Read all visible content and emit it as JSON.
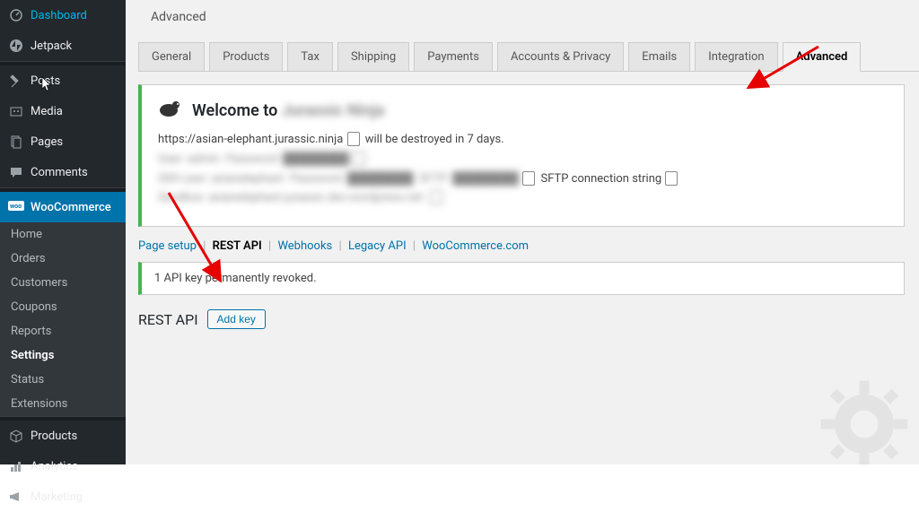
{
  "sidebar": {
    "items": [
      {
        "label": "Dashboard",
        "icon": "dashboard"
      },
      {
        "label": "Jetpack",
        "icon": "jetpack"
      },
      {
        "label": "Posts",
        "icon": "pin"
      },
      {
        "label": "Media",
        "icon": "media"
      },
      {
        "label": "Pages",
        "icon": "page"
      },
      {
        "label": "Comments",
        "icon": "comment"
      },
      {
        "label": "WooCommerce",
        "icon": "woo",
        "current": true
      },
      {
        "label": "Products",
        "icon": "products"
      },
      {
        "label": "Analytics",
        "icon": "analytics"
      },
      {
        "label": "Marketing",
        "icon": "marketing"
      }
    ],
    "submenu": [
      "Home",
      "Orders",
      "Customers",
      "Coupons",
      "Reports",
      "Settings",
      "Status",
      "Extensions"
    ],
    "submenu_current": "Settings"
  },
  "page": {
    "title": "Advanced"
  },
  "tabs": [
    "General",
    "Products",
    "Tax",
    "Shipping",
    "Payments",
    "Accounts & Privacy",
    "Emails",
    "Integration",
    "Advanced"
  ],
  "tabs_active": "Advanced",
  "welcome": {
    "heading": "Welcome to",
    "url": "https://asian-elephant.jurassic.ninja",
    "destroy_text": " will be destroyed in 7 days.",
    "sftp_label": "SFTP connection string"
  },
  "sublinks": [
    "Page setup",
    "REST API",
    "Webhooks",
    "Legacy API",
    "WooCommerce.com"
  ],
  "sublinks_active": "REST API",
  "notice": "1 API key permanently revoked.",
  "rest": {
    "heading": "REST API",
    "button": "Add key"
  }
}
